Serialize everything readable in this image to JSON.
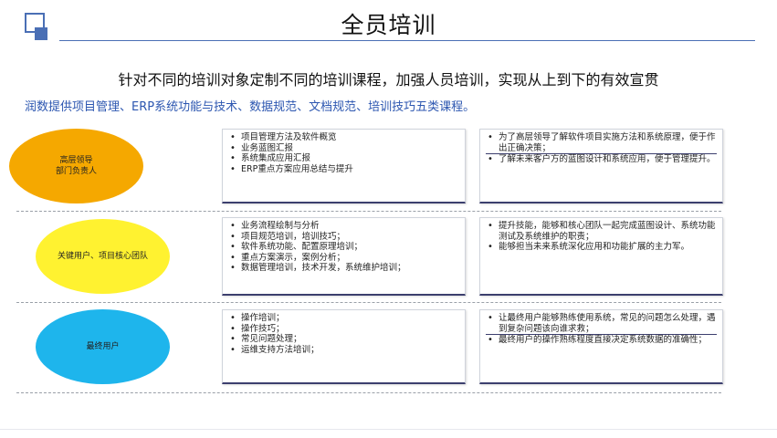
{
  "header": {
    "title": "全员培训"
  },
  "subtitle": "针对不同的培训对象定制不同的培训课程，加强人员培训，实现从上到下的有效宣贯",
  "intro": "润数提供项目管理、ERP系统功能与技术、数据规范、文档规范、培训技巧五类课程。",
  "rows": [
    {
      "audience_lines": [
        "高层领导",
        "部门负责人"
      ],
      "audience_color": "#f5a800",
      "courses": [
        "项目管理方法及软件概览",
        "业务蓝图汇报",
        "系统集成应用汇报",
        "ERP重点方案应用总结与提升"
      ],
      "goals": [
        "为了高层领导了解软件项目实施方法和系统原理，便于作出正确决策；",
        "了解未来客户方的蓝图设计和系统应用，便于管理提升。"
      ]
    },
    {
      "audience_lines": [
        "关键用户、项目核心团队"
      ],
      "audience_color": "#fff230",
      "courses": [
        "业务流程绘制与分析",
        "项目规范培训，培训技巧；",
        "软件系统功能、配置原理培训；",
        "重点方案演示，案例分析；",
        "数据管理培训，技术开发，系统维护培训；"
      ],
      "goals": [
        "提升技能，能够和核心团队一起完成蓝图设计、系统功能测试及系统维护的职责；",
        "能够担当未来系统深化应用和功能扩展的主力军。"
      ]
    },
    {
      "audience_lines": [
        "最终用户"
      ],
      "audience_color": "#1eb5ec",
      "courses": [
        "操作培训；",
        "操作技巧；",
        "常见问题处理；",
        "运维支持方法培训；"
      ],
      "goals": [
        "让最终用户能够熟练使用系统，常见的问题怎么处理，遇到复杂问题该向谁求救；",
        "最终用户的操作熟练程度直接决定系统数据的准确性；"
      ]
    }
  ]
}
